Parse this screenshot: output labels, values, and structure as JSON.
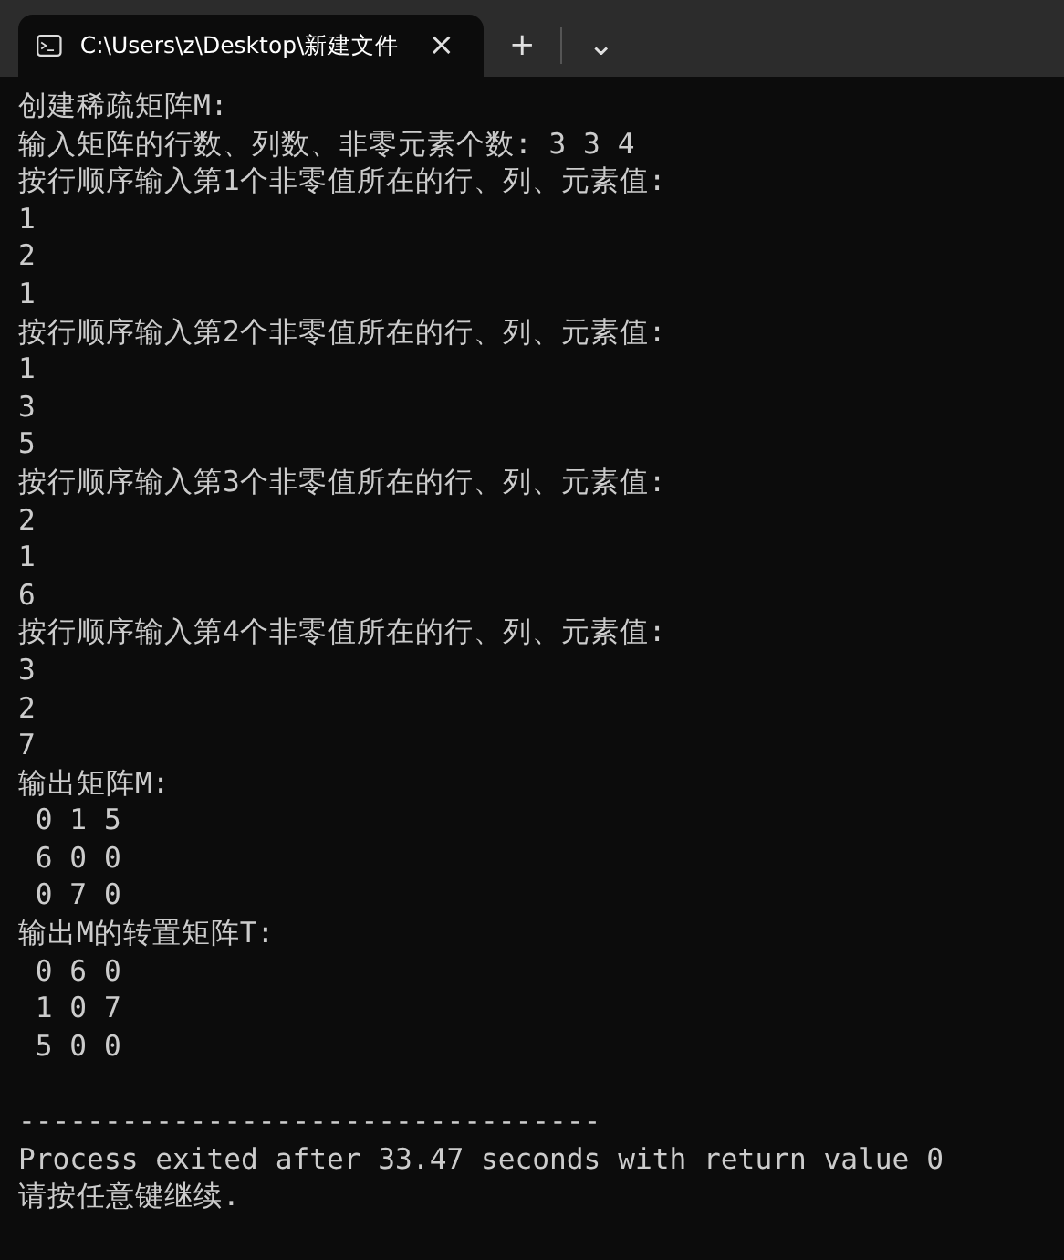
{
  "tab": {
    "title": "C:\\Users\\z\\Desktop\\新建文件",
    "close": "×",
    "selected": true
  },
  "new_tab": "+",
  "dropdown": "⌄",
  "console_lines": [
    "创建稀疏矩阵M:",
    "输入矩阵的行数、列数、非零元素个数: 3 3 4",
    "按行顺序输入第1个非零值所在的行、列、元素值:",
    "1",
    "2",
    "1",
    "按行顺序输入第2个非零值所在的行、列、元素值:",
    "1",
    "3",
    "5",
    "按行顺序输入第3个非零值所在的行、列、元素值:",
    "2",
    "1",
    "6",
    "按行顺序输入第4个非零值所在的行、列、元素值:",
    "3",
    "2",
    "7",
    "输出矩阵M:",
    " 0 1 5",
    " 6 0 0",
    " 0 7 0",
    "输出M的转置矩阵T:",
    " 0 6 0",
    " 1 0 7",
    " 5 0 0"
  ],
  "footer_lines": [
    "----------------------------------",
    "Process exited after 33.47 seconds with return value 0",
    "请按任意键继续."
  ]
}
